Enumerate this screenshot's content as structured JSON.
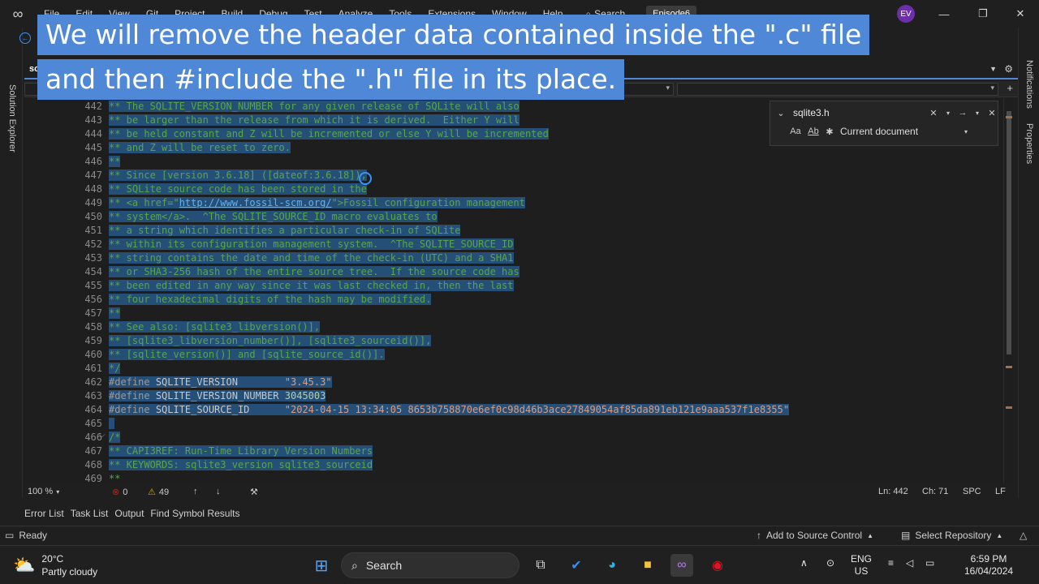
{
  "titlebar": {
    "menu": [
      "File",
      "Edit",
      "View",
      "Git",
      "Project",
      "Build",
      "Debug",
      "Test",
      "Analyze",
      "Tools",
      "Extensions",
      "Window",
      "Help"
    ],
    "search_label": "Search",
    "solution_name": "Episode6",
    "avatar_initials": "EV"
  },
  "captions": {
    "line1": "We will remove the header data contained inside the \".c\" file",
    "line2": "and then #include the \".h\" file in its place."
  },
  "sidebars": {
    "left": "Solution Explorer",
    "right_top": "Notifications",
    "right_bottom": "Properties"
  },
  "tab": {
    "label": "sc"
  },
  "find": {
    "query": "sqlite3.h",
    "scope": "Current document",
    "match_case_label": "Aa",
    "whole_word_label": "Ab"
  },
  "editor": {
    "lines": [
      {
        "n": "442",
        "text": "** The SQLITE_VERSION_NUMBER for any given release of SQLite will also"
      },
      {
        "n": "443",
        "text": "** be larger than the release from which it is derived.  Either Y will"
      },
      {
        "n": "444",
        "text": "** be held constant and Z will be incremented or else Y will be incremented"
      },
      {
        "n": "445",
        "text": "** and Z will be reset to zero."
      },
      {
        "n": "446",
        "text": "**"
      },
      {
        "n": "447",
        "text": "** Since [version 3.6.18] ([dateof:3.6.18]),"
      },
      {
        "n": "448",
        "text": "** SQLite source code has been stored in the"
      },
      {
        "n": "449",
        "text": "** <a href=\"",
        "link": "http://www.fossil-scm.org/",
        "after": "\">Fossil configuration management"
      },
      {
        "n": "450",
        "text": "** system</a>.  ^The SQLITE_SOURCE_ID macro evaluates to"
      },
      {
        "n": "451",
        "text": "** a string which identifies a particular check-in of SQLite"
      },
      {
        "n": "452",
        "text": "** within its configuration management system.  ^The SQLITE_SOURCE_ID"
      },
      {
        "n": "453",
        "text": "** string contains the date and time of the check-in (UTC) and a SHA1"
      },
      {
        "n": "454",
        "text": "** or SHA3-256 hash of the entire source tree.  If the source code has"
      },
      {
        "n": "455",
        "text": "** been edited in any way since it was last checked in, then the last"
      },
      {
        "n": "456",
        "text": "** four hexadecimal digits of the hash may be modified."
      },
      {
        "n": "457",
        "text": "**"
      },
      {
        "n": "458",
        "text": "** See also: [sqlite3_libversion()],"
      },
      {
        "n": "459",
        "text": "** [sqlite3_libversion_number()], [sqlite3_sourceid()],"
      },
      {
        "n": "460",
        "text": "** [sqlite_version()] and [sqlite_source_id()]."
      },
      {
        "n": "461",
        "text": "*/"
      },
      {
        "n": "462",
        "kw": "#define",
        "macro": "SQLITE_VERSION",
        "pad": "        ",
        "value": "\"3.45.3\"",
        "vtype": "str"
      },
      {
        "n": "463",
        "kw": "#define",
        "macro": "SQLITE_VERSION_NUMBER",
        "pad": " ",
        "value": "3045003",
        "vtype": "num"
      },
      {
        "n": "464",
        "kw": "#define",
        "macro": "SQLITE_SOURCE_ID",
        "pad": "      ",
        "value": "\"2024-04-15 13:34:05 8653b758870e6ef0c98d46b3ace27849054af85da891eb121e9aaa537f1e8355\"",
        "vtype": "str"
      },
      {
        "n": "465",
        "text": ""
      },
      {
        "n": "466",
        "text": "/*"
      },
      {
        "n": "467",
        "text": "** CAPI3REF: Run-Time Library Version Numbers"
      },
      {
        "n": "468",
        "text": "** KEYWORDS: sqlite3_version sqlite3_sourceid"
      },
      {
        "n": "469",
        "text": "**"
      }
    ]
  },
  "editor_status": {
    "zoom": "100 %",
    "errors": "0",
    "warnings": "49",
    "line": "Ln: 442",
    "char": "Ch: 71",
    "whitespace": "SPC",
    "line_ending": "LF"
  },
  "tool_tabs": [
    "Error List",
    "Task List",
    "Output",
    "Find Symbol Results"
  ],
  "status": {
    "ready": "Ready",
    "source_control": "Add to Source Control",
    "repository": "Select Repository"
  },
  "taskbar": {
    "temperature": "20°C",
    "weather": "Partly cloudy",
    "search": "Search",
    "lang": "ENG",
    "region": "US",
    "time": "6:59 PM",
    "date": "16/04/2024"
  },
  "colors": {
    "accent": "#4f88d6",
    "selection": "#264f78",
    "comment": "#57a64a",
    "string": "#d69d85"
  }
}
